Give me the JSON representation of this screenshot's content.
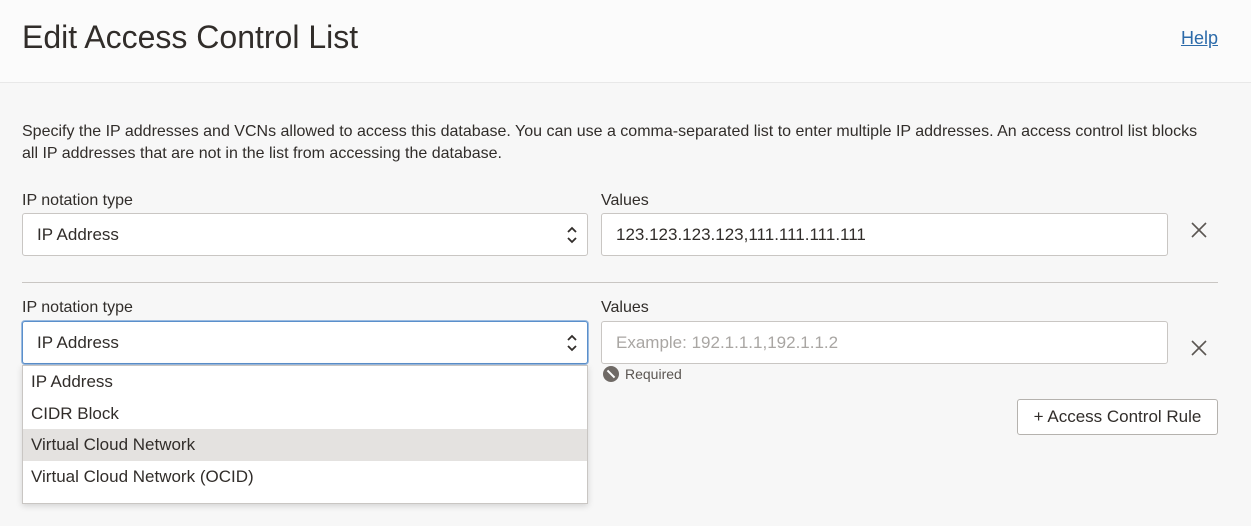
{
  "header": {
    "title": "Edit Access Control List",
    "help_label": "Help"
  },
  "description": "Specify the IP addresses and VCNs allowed to access this database. You can use a comma-separated list to enter multiple IP addresses. An access control list blocks all IP addresses that are not in the list from accessing the database.",
  "rules": [
    {
      "notation_label": "IP notation type",
      "notation_value": "IP Address",
      "values_label": "Values",
      "values_value": "123.123.123.123,111.111.111.111"
    },
    {
      "notation_label": "IP notation type",
      "notation_value": "IP Address",
      "values_label": "Values",
      "values_placeholder": "Example: 192.1.1.1,192.1.1.2",
      "required_text": "Required"
    }
  ],
  "dropdown": {
    "options": [
      "IP Address",
      "CIDR Block",
      "Virtual Cloud Network",
      "Virtual Cloud Network (OCID)"
    ],
    "highlighted": "Virtual Cloud Network"
  },
  "add_rule_label": "+ Access Control Rule",
  "colors": {
    "link": "#2b6aa9",
    "focus_border": "#5a8fcb",
    "highlight": "#e4e2e0"
  },
  "icons": {
    "select_chevrons": "up-down-chevron-icon",
    "remove": "close-icon",
    "required": "required-icon"
  }
}
